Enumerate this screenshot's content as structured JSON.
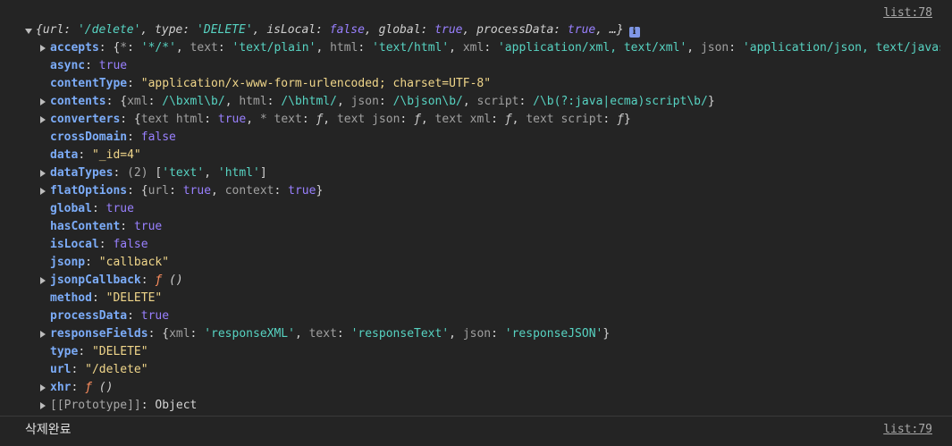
{
  "entry1": {
    "source_link": "list:78",
    "summary": {
      "open": "{",
      "k_url": "url",
      "v_url": "'/delete'",
      "k_type": "type",
      "v_type": "'DELETE'",
      "k_isLocal": "isLocal",
      "v_isLocal": "false",
      "k_global": "global",
      "v_global": "true",
      "k_processData": "processData",
      "v_processData": "true",
      "ellipsis": ", …}",
      "info_icon": "i"
    },
    "props": {
      "accepts": {
        "key": "accepts",
        "k1": "*",
        "v1": "'*/*'",
        "k2": "text",
        "v2": "'text/plain'",
        "k3": "html",
        "v3": "'text/html'",
        "k4": "xml",
        "v4": "'application/xml, text/xml'",
        "k5": "json",
        "v5": "'application/json, text/javascript'"
      },
      "async": {
        "key": "async",
        "value": "true"
      },
      "contentType": {
        "key": "contentType",
        "value": "\"application/x-www-form-urlencoded; charset=UTF-8\""
      },
      "contents": {
        "key": "contents",
        "k1": "xml",
        "v1": "/\\bxml\\b/",
        "k2": "html",
        "v2": "/\\bhtml/",
        "k3": "json",
        "v3": "/\\bjson\\b/",
        "k4": "script",
        "v4": "/\\b(?:java|ecma)script\\b/"
      },
      "converters": {
        "key": "converters",
        "k1": "text html",
        "v1": "true",
        "k2": "* text",
        "v2": "ƒ",
        "k3": "text json",
        "v3": "ƒ",
        "k4": "text xml",
        "v4": "ƒ",
        "k5": "text script",
        "v5": "ƒ"
      },
      "crossDomain": {
        "key": "crossDomain",
        "value": "false"
      },
      "data": {
        "key": "data",
        "value": "\"_id=4\""
      },
      "dataTypes": {
        "key": "dataTypes",
        "count": "(2)",
        "v1": "'text'",
        "v2": "'html'"
      },
      "flatOptions": {
        "key": "flatOptions",
        "k1": "url",
        "v1": "true",
        "k2": "context",
        "v2": "true"
      },
      "global": {
        "key": "global",
        "value": "true"
      },
      "hasContent": {
        "key": "hasContent",
        "value": "true"
      },
      "isLocal": {
        "key": "isLocal",
        "value": "false"
      },
      "jsonp": {
        "key": "jsonp",
        "value": "\"callback\""
      },
      "jsonpCallback": {
        "key": "jsonpCallback",
        "fn": "ƒ",
        "sig": "()"
      },
      "method": {
        "key": "method",
        "value": "\"DELETE\""
      },
      "processData": {
        "key": "processData",
        "value": "true"
      },
      "responseFields": {
        "key": "responseFields",
        "k1": "xml",
        "v1": "'responseXML'",
        "k2": "text",
        "v2": "'responseText'",
        "k3": "json",
        "v3": "'responseJSON'"
      },
      "type": {
        "key": "type",
        "value": "\"DELETE\""
      },
      "url": {
        "key": "url",
        "value": "\"/delete\""
      },
      "xhr": {
        "key": "xhr",
        "fn": "ƒ",
        "sig": "()"
      },
      "prototype": {
        "key": "[[Prototype]]",
        "value": "Object"
      }
    }
  },
  "entry2": {
    "message": "삭제완료",
    "source_link": "list:79"
  }
}
